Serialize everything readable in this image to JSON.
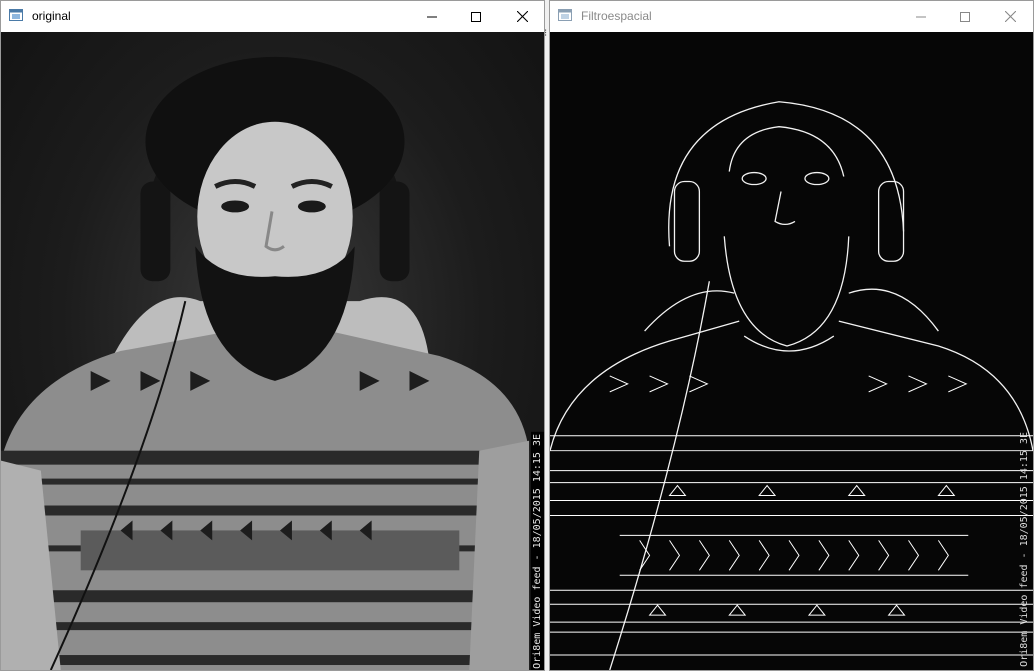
{
  "windows": [
    {
      "id": "original",
      "title": "original",
      "title_color": "#000000",
      "overlay_text": "Ori8em Video feed - 18/05/2015 14:15 3E"
    },
    {
      "id": "filtroespacial",
      "title": "Filtroespacial",
      "title_color": "#8a8a8a",
      "overlay_text": "Ori8em Video feed - 18/05/2015 14:15 3E"
    }
  ],
  "icons": {
    "app": "opencv-window-icon",
    "minimize": "minimize-icon",
    "maximize": "maximize-icon",
    "close": "close-icon"
  },
  "colors": {
    "titlebar_bg": "#ffffff",
    "window_border": "#9a9a9a",
    "filtered_bg": "#060606",
    "edges": "#ffffff"
  }
}
